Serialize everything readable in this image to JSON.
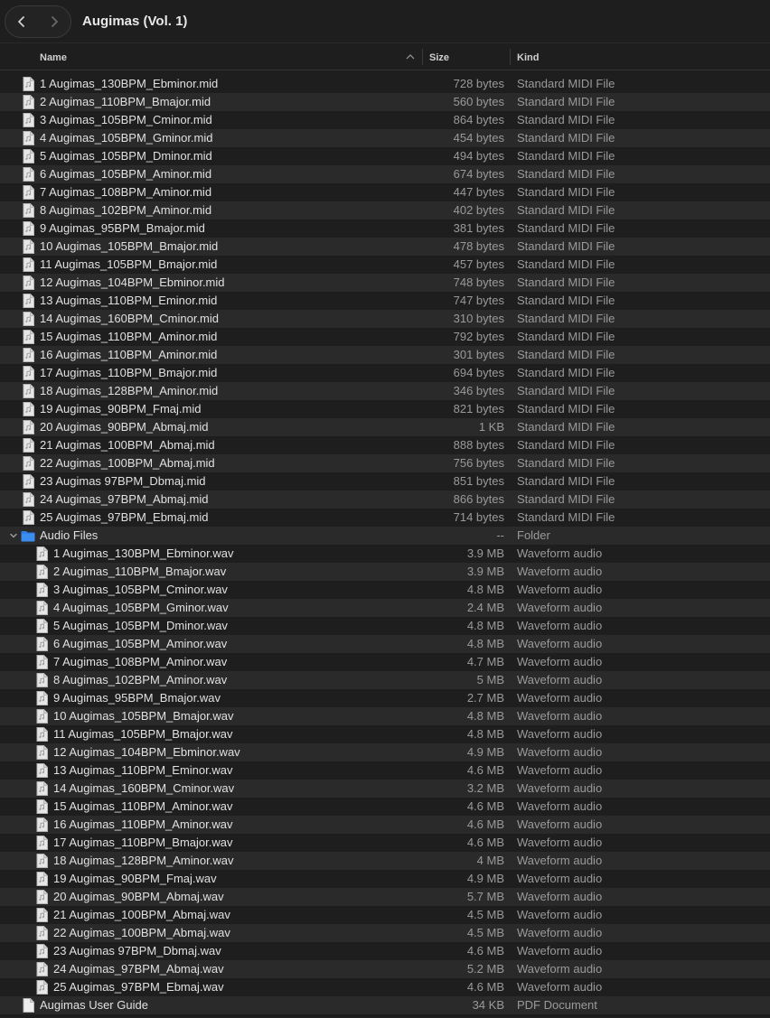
{
  "window": {
    "title": "Augimas (Vol. 1)"
  },
  "nav": {
    "back": "chevron-left-icon",
    "forward": "chevron-right-icon"
  },
  "columns": {
    "name": "Name",
    "size": "Size",
    "kind": "Kind"
  },
  "rows": [
    {
      "name": "1 Augimas_130BPM_Ebminor.mid",
      "size": "728 bytes",
      "kind": "Standard MIDI File",
      "depth": 0,
      "icon": "midi-file-icon"
    },
    {
      "name": "2 Augimas_110BPM_Bmajor.mid",
      "size": "560 bytes",
      "kind": "Standard MIDI File",
      "depth": 0,
      "icon": "midi-file-icon"
    },
    {
      "name": "3 Augimas_105BPM_Cminor.mid",
      "size": "864 bytes",
      "kind": "Standard MIDI File",
      "depth": 0,
      "icon": "midi-file-icon"
    },
    {
      "name": "4 Augimas_105BPM_Gminor.mid",
      "size": "454 bytes",
      "kind": "Standard MIDI File",
      "depth": 0,
      "icon": "midi-file-icon"
    },
    {
      "name": "5 Augimas_105BPM_Dminor.mid",
      "size": "494 bytes",
      "kind": "Standard MIDI File",
      "depth": 0,
      "icon": "midi-file-icon"
    },
    {
      "name": "6 Augimas_105BPM_Aminor.mid",
      "size": "674 bytes",
      "kind": "Standard MIDI File",
      "depth": 0,
      "icon": "midi-file-icon"
    },
    {
      "name": "7 Augimas_108BPM_Aminor.mid",
      "size": "447 bytes",
      "kind": "Standard MIDI File",
      "depth": 0,
      "icon": "midi-file-icon"
    },
    {
      "name": "8 Augimas_102BPM_Aminor.mid",
      "size": "402 bytes",
      "kind": "Standard MIDI File",
      "depth": 0,
      "icon": "midi-file-icon"
    },
    {
      "name": "9 Augimas_95BPM_Bmajor.mid",
      "size": "381 bytes",
      "kind": "Standard MIDI File",
      "depth": 0,
      "icon": "midi-file-icon"
    },
    {
      "name": "10 Augimas_105BPM_Bmajor.mid",
      "size": "478 bytes",
      "kind": "Standard MIDI File",
      "depth": 0,
      "icon": "midi-file-icon"
    },
    {
      "name": "11 Augimas_105BPM_Bmajor.mid",
      "size": "457 bytes",
      "kind": "Standard MIDI File",
      "depth": 0,
      "icon": "midi-file-icon"
    },
    {
      "name": "12 Augimas_104BPM_Ebminor.mid",
      "size": "748 bytes",
      "kind": "Standard MIDI File",
      "depth": 0,
      "icon": "midi-file-icon"
    },
    {
      "name": "13 Augimas_110BPM_Eminor.mid",
      "size": "747 bytes",
      "kind": "Standard MIDI File",
      "depth": 0,
      "icon": "midi-file-icon"
    },
    {
      "name": "14 Augimas_160BPM_Cminor.mid",
      "size": "310 bytes",
      "kind": "Standard MIDI File",
      "depth": 0,
      "icon": "midi-file-icon"
    },
    {
      "name": "15 Augimas_110BPM_Aminor.mid",
      "size": "792 bytes",
      "kind": "Standard MIDI File",
      "depth": 0,
      "icon": "midi-file-icon"
    },
    {
      "name": "16 Augimas_110BPM_Aminor.mid",
      "size": "301 bytes",
      "kind": "Standard MIDI File",
      "depth": 0,
      "icon": "midi-file-icon"
    },
    {
      "name": "17 Augimas_110BPM_Bmajor.mid",
      "size": "694 bytes",
      "kind": "Standard MIDI File",
      "depth": 0,
      "icon": "midi-file-icon"
    },
    {
      "name": "18 Augimas_128BPM_Aminor.mid",
      "size": "346 bytes",
      "kind": "Standard MIDI File",
      "depth": 0,
      "icon": "midi-file-icon"
    },
    {
      "name": "19 Augimas_90BPM_Fmaj.mid",
      "size": "821 bytes",
      "kind": "Standard MIDI File",
      "depth": 0,
      "icon": "midi-file-icon"
    },
    {
      "name": "20 Augimas_90BPM_Abmaj.mid",
      "size": "1 KB",
      "kind": "Standard MIDI File",
      "depth": 0,
      "icon": "midi-file-icon"
    },
    {
      "name": "21 Augimas_100BPM_Abmaj.mid",
      "size": "888 bytes",
      "kind": "Standard MIDI File",
      "depth": 0,
      "icon": "midi-file-icon"
    },
    {
      "name": "22 Augimas_100BPM_Abmaj.mid",
      "size": "756 bytes",
      "kind": "Standard MIDI File",
      "depth": 0,
      "icon": "midi-file-icon"
    },
    {
      "name": "23 Augimas 97BPM_Dbmaj.mid",
      "size": "851 bytes",
      "kind": "Standard MIDI File",
      "depth": 0,
      "icon": "midi-file-icon"
    },
    {
      "name": "24 Augimas_97BPM_Abmaj.mid",
      "size": "866 bytes",
      "kind": "Standard MIDI File",
      "depth": 0,
      "icon": "midi-file-icon"
    },
    {
      "name": "25 Augimas_97BPM_Ebmaj.mid",
      "size": "714 bytes",
      "kind": "Standard MIDI File",
      "depth": 0,
      "icon": "midi-file-icon"
    },
    {
      "name": "Audio Files",
      "size": "--",
      "kind": "Folder",
      "depth": 0,
      "icon": "folder-icon",
      "expanded": true
    },
    {
      "name": "1 Augimas_130BPM_Ebminor.wav",
      "size": "3.9 MB",
      "kind": "Waveform audio",
      "depth": 1,
      "icon": "audio-file-icon"
    },
    {
      "name": "2 Augimas_110BPM_Bmajor.wav",
      "size": "3.9 MB",
      "kind": "Waveform audio",
      "depth": 1,
      "icon": "audio-file-icon"
    },
    {
      "name": "3 Augimas_105BPM_Cminor.wav",
      "size": "4.8 MB",
      "kind": "Waveform audio",
      "depth": 1,
      "icon": "audio-file-icon"
    },
    {
      "name": "4 Augimas_105BPM_Gminor.wav",
      "size": "2.4 MB",
      "kind": "Waveform audio",
      "depth": 1,
      "icon": "audio-file-icon"
    },
    {
      "name": "5 Augimas_105BPM_Dminor.wav",
      "size": "4.8 MB",
      "kind": "Waveform audio",
      "depth": 1,
      "icon": "audio-file-icon"
    },
    {
      "name": "6 Augimas_105BPM_Aminor.wav",
      "size": "4.8 MB",
      "kind": "Waveform audio",
      "depth": 1,
      "icon": "audio-file-icon"
    },
    {
      "name": "7 Augimas_108BPM_Aminor.wav",
      "size": "4.7 MB",
      "kind": "Waveform audio",
      "depth": 1,
      "icon": "audio-file-icon"
    },
    {
      "name": "8 Augimas_102BPM_Aminor.wav",
      "size": "5 MB",
      "kind": "Waveform audio",
      "depth": 1,
      "icon": "audio-file-icon"
    },
    {
      "name": "9 Augimas_95BPM_Bmajor.wav",
      "size": "2.7 MB",
      "kind": "Waveform audio",
      "depth": 1,
      "icon": "audio-file-icon"
    },
    {
      "name": "10 Augimas_105BPM_Bmajor.wav",
      "size": "4.8 MB",
      "kind": "Waveform audio",
      "depth": 1,
      "icon": "audio-file-icon"
    },
    {
      "name": "11 Augimas_105BPM_Bmajor.wav",
      "size": "4.8 MB",
      "kind": "Waveform audio",
      "depth": 1,
      "icon": "audio-file-icon"
    },
    {
      "name": "12 Augimas_104BPM_Ebminor.wav",
      "size": "4.9 MB",
      "kind": "Waveform audio",
      "depth": 1,
      "icon": "audio-file-icon"
    },
    {
      "name": "13 Augimas_110BPM_Eminor.wav",
      "size": "4.6 MB",
      "kind": "Waveform audio",
      "depth": 1,
      "icon": "audio-file-icon"
    },
    {
      "name": "14 Augimas_160BPM_Cminor.wav",
      "size": "3.2 MB",
      "kind": "Waveform audio",
      "depth": 1,
      "icon": "audio-file-icon"
    },
    {
      "name": "15 Augimas_110BPM_Aminor.wav",
      "size": "4.6 MB",
      "kind": "Waveform audio",
      "depth": 1,
      "icon": "audio-file-icon"
    },
    {
      "name": "16 Augimas_110BPM_Aminor.wav",
      "size": "4.6 MB",
      "kind": "Waveform audio",
      "depth": 1,
      "icon": "audio-file-icon"
    },
    {
      "name": "17 Augimas_110BPM_Bmajor.wav",
      "size": "4.6 MB",
      "kind": "Waveform audio",
      "depth": 1,
      "icon": "audio-file-icon"
    },
    {
      "name": "18 Augimas_128BPM_Aminor.wav",
      "size": "4 MB",
      "kind": "Waveform audio",
      "depth": 1,
      "icon": "audio-file-icon"
    },
    {
      "name": "19 Augimas_90BPM_Fmaj.wav",
      "size": "4.9 MB",
      "kind": "Waveform audio",
      "depth": 1,
      "icon": "audio-file-icon"
    },
    {
      "name": "20 Augimas_90BPM_Abmaj.wav",
      "size": "5.7 MB",
      "kind": "Waveform audio",
      "depth": 1,
      "icon": "audio-file-icon"
    },
    {
      "name": "21 Augimas_100BPM_Abmaj.wav",
      "size": "4.5 MB",
      "kind": "Waveform audio",
      "depth": 1,
      "icon": "audio-file-icon"
    },
    {
      "name": "22 Augimas_100BPM_Abmaj.wav",
      "size": "4.5 MB",
      "kind": "Waveform audio",
      "depth": 1,
      "icon": "audio-file-icon"
    },
    {
      "name": "23 Augimas 97BPM_Dbmaj.wav",
      "size": "4.6 MB",
      "kind": "Waveform audio",
      "depth": 1,
      "icon": "audio-file-icon"
    },
    {
      "name": "24 Augimas_97BPM_Abmaj.wav",
      "size": "5.2 MB",
      "kind": "Waveform audio",
      "depth": 1,
      "icon": "audio-file-icon"
    },
    {
      "name": "25 Augimas_97BPM_Ebmaj.wav",
      "size": "4.6 MB",
      "kind": "Waveform audio",
      "depth": 1,
      "icon": "audio-file-icon"
    },
    {
      "name": "Augimas User Guide",
      "size": "34 KB",
      "kind": "PDF Document",
      "depth": 0,
      "icon": "pdf-file-icon"
    }
  ],
  "colors": {
    "background": "#1e1e1e",
    "alt_row": "#2a2a2a",
    "text": "#e0e0e0",
    "secondary_text": "#9a9a9a",
    "folder": "#3b8ef0"
  }
}
